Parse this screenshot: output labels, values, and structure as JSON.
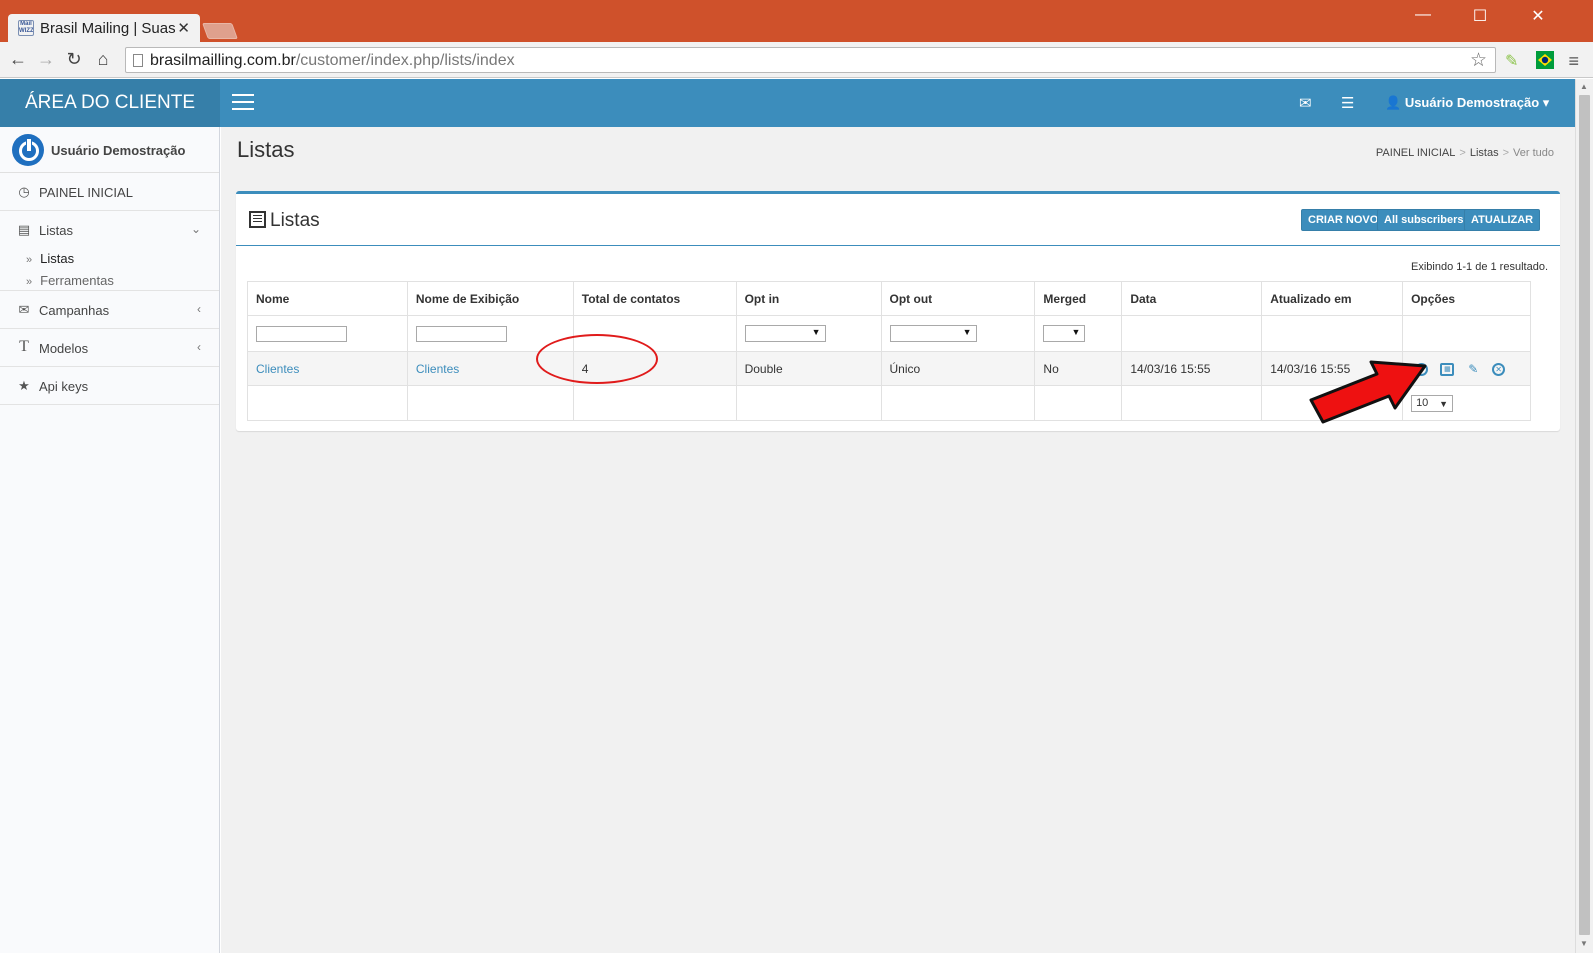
{
  "browser": {
    "tab_title": "Brasil Mailing | Suas",
    "tab_favicon_text": "Mail WIZZ",
    "tab_close": "✕",
    "url_domain": "brasilmailling.com.br",
    "url_path": "/customer/index.php/lists/index",
    "window_controls": {
      "minimize": "—",
      "maximize": "☐",
      "close": "✕"
    }
  },
  "header": {
    "logo": "ÁREA DO CLIENTE",
    "user": "Usuário Demostração ▾"
  },
  "sidebar": {
    "user_name": "Usuário Demostração",
    "items": [
      {
        "label": "PAINEL INICIAL",
        "icon": "dashboard-icon"
      },
      {
        "label": "Listas",
        "icon": "list-icon"
      },
      {
        "label": "Campanhas",
        "icon": "envelope-icon"
      },
      {
        "label": "Modelos",
        "icon": "text-icon"
      },
      {
        "label": "Api keys",
        "icon": "star-icon"
      }
    ],
    "subitems": [
      {
        "label": "Listas"
      },
      {
        "label": "Ferramentas"
      }
    ]
  },
  "page": {
    "title": "Listas",
    "breadcrumb": [
      "PAINEL INICIAL",
      "Listas",
      "Ver tudo"
    ]
  },
  "box": {
    "title": "Listas",
    "buttons": {
      "create": "CRIAR NOVO",
      "all_subscribers": "All subscribers",
      "refresh": "ATUALIZAR"
    },
    "summary": "Exibindo 1-1 de 1 resultado."
  },
  "table": {
    "headers": [
      "Nome",
      "Nome de Exibição",
      "Total de contatos",
      "Opt in",
      "Opt out",
      "Merged",
      "Data",
      "Atualizado em",
      "Opções"
    ],
    "rows": [
      {
        "name": "Clientes",
        "display_name": "Clientes",
        "total": "4",
        "opt_in": "Double",
        "opt_out": "Único",
        "merged": "No",
        "date": "14/03/16 15:55",
        "updated": "14/03/16 15:55"
      }
    ],
    "page_size": "10"
  },
  "colors": {
    "accent": "#3c8dbc",
    "header_dark": "#367fa9",
    "chrome_title": "#cf512b",
    "annotation": "#e01b1b"
  }
}
